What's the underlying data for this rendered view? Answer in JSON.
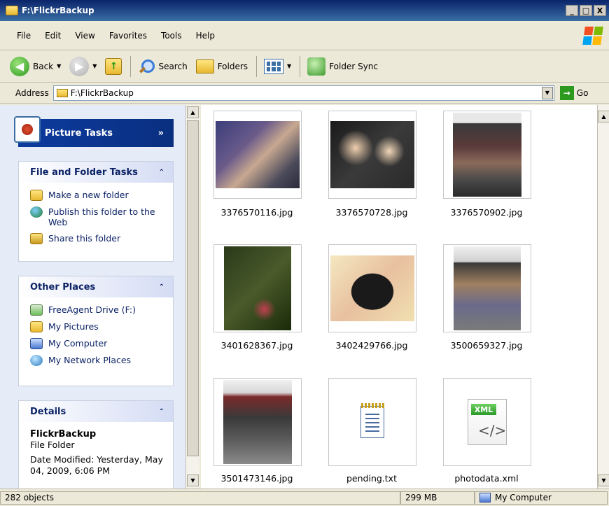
{
  "window": {
    "title": "F:\\FlickrBackup",
    "controls": [
      "_",
      "□",
      "X"
    ]
  },
  "menu": [
    "File",
    "Edit",
    "View",
    "Favorites",
    "Tools",
    "Help"
  ],
  "toolbar": {
    "back": "Back",
    "search": "Search",
    "folders": "Folders",
    "folder_sync": "Folder Sync"
  },
  "address": {
    "label": "Address",
    "value": "F:\\FlickrBackup",
    "go": "Go"
  },
  "tasks": {
    "picture_tasks": "Picture Tasks",
    "file_folder": {
      "title": "File and Folder Tasks",
      "items": [
        "Make a new folder",
        "Publish this folder to the Web",
        "Share this folder"
      ]
    },
    "other_places": {
      "title": "Other Places",
      "items": [
        "FreeAgent Drive (F:)",
        "My Pictures",
        "My Computer",
        "My Network Places"
      ]
    },
    "details": {
      "title": "Details",
      "name": "FlickrBackup",
      "type": "File Folder",
      "date": "Date Modified: Yesterday, May 04, 2009, 6:06 PM"
    }
  },
  "files": [
    {
      "name": "3376570116.jpg"
    },
    {
      "name": "3376570728.jpg"
    },
    {
      "name": "3376570902.jpg"
    },
    {
      "name": "3401628367.jpg"
    },
    {
      "name": "3402429766.jpg"
    },
    {
      "name": "3500659327.jpg"
    },
    {
      "name": "3501473146.jpg"
    },
    {
      "name": "pending.txt"
    },
    {
      "name": "photodata.xml",
      "badge": "XML",
      "code": "</>"
    }
  ],
  "status": {
    "objects": "282 objects",
    "size": "299 MB",
    "zone": "My Computer"
  }
}
